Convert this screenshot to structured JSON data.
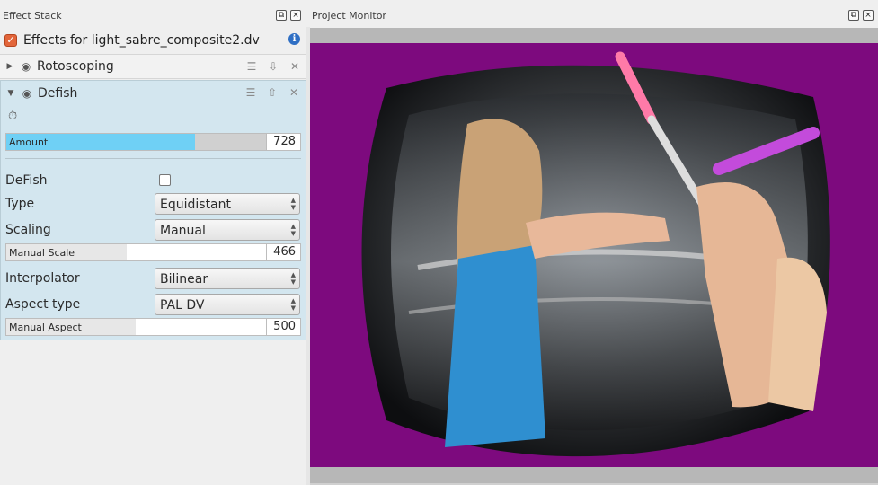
{
  "effect_stack": {
    "title": "Effect Stack",
    "header_title": "Effects for light_sabre_composite2.dv",
    "effects": [
      {
        "name": "Rotoscoping",
        "expanded": false
      },
      {
        "name": "Defish",
        "expanded": true
      }
    ]
  },
  "defish": {
    "amount": {
      "label": "Amount",
      "value": "728",
      "fraction": 0.728
    },
    "defish_label": "DeFish",
    "defish_checked": false,
    "type": {
      "label": "Type",
      "value": "Equidistant"
    },
    "scaling": {
      "label": "Scaling",
      "value": "Manual"
    },
    "manual_scale": {
      "label": "Manual Scale",
      "value": "466",
      "fraction": 0.466
    },
    "interpolator": {
      "label": "Interpolator",
      "value": "Bilinear"
    },
    "aspect_type": {
      "label": "Aspect type",
      "value": "PAL DV"
    },
    "manual_aspect": {
      "label": "Manual Aspect",
      "value": "500",
      "fraction": 0.5
    }
  },
  "project_monitor": {
    "title": "Project Monitor",
    "background_color": "#7d0a7e"
  },
  "colors": {
    "accent_checkbox": "#e2653a",
    "slider_fill_active": "#6fd0f5",
    "panel_bg": "#d3e6ef"
  }
}
